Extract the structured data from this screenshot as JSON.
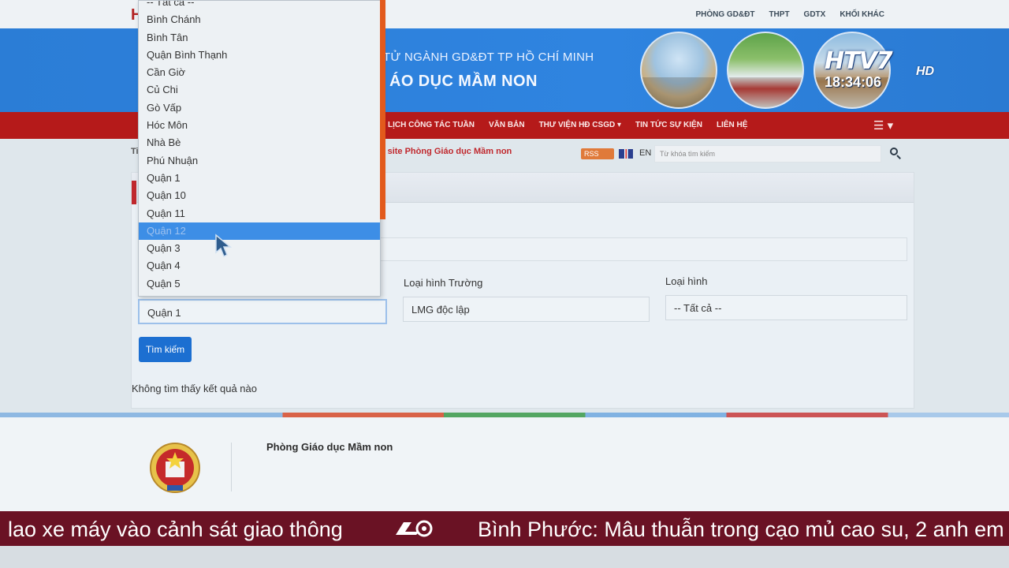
{
  "topbar": {
    "brand": "H",
    "links": [
      "PHÒNG GD&ĐT",
      "THPT",
      "GDTX",
      "KHỐI KHÁC"
    ]
  },
  "banner": {
    "line1": "TỬ NGÀNH GD&ĐT TP HỒ CHÍ MINH",
    "line2": "ÁO DỤC MẦM NON"
  },
  "overlay": {
    "channel_logo": "HTV7",
    "hd_label": "HD",
    "clock": "18:34:06"
  },
  "nav": {
    "items": [
      "LỊCH CÔNG TÁC TUẦN",
      "VĂN BẢN",
      "THƯ VIỆN HĐ CSGD ▾",
      "TIN TỨC SỰ KIỆN",
      "LIÊN HỆ"
    ],
    "menu_glyph": "☰ ▾"
  },
  "breadcrumb": {
    "prefix": "Ti",
    "current": "site Phòng Giáo dục Mầm non"
  },
  "tools": {
    "rss_label": "RSS",
    "lang_label": "EN",
    "search_placeholder": "Từ khóa tìm kiếm"
  },
  "form": {
    "district_value": "Quận 1",
    "school_type_label": "Loại hình Trường",
    "school_type_value": "LMG độc lập",
    "type_label": "Loại hình",
    "type_value": "-- Tất cả --",
    "search_button": "Tìm kiếm",
    "no_result": "Không tìm thấy kết quả nào"
  },
  "dropdown": {
    "options": [
      "-- Tất cả --",
      "Bình Chánh",
      "Bình Tân",
      "Quận Bình Thạnh",
      "Cần Giờ",
      "Củ Chi",
      "Gò Vấp",
      "Hóc Môn",
      "Nhà Bè",
      "Phú Nhuận",
      "Quận 1",
      "Quận 10",
      "Quận 11",
      "Quận 12",
      "Quận 3",
      "Quận 4",
      "Quận 5"
    ],
    "highlighted": "Quận 12"
  },
  "footer": {
    "org_name": "Phòng Giáo dục Mầm non"
  },
  "ticker": {
    "left_text": "lao xe máy vào cảnh sát giao thông",
    "right_text": "Bình Phước: Mâu thuẫn trong cạo mủ cao su, 2 anh em"
  }
}
